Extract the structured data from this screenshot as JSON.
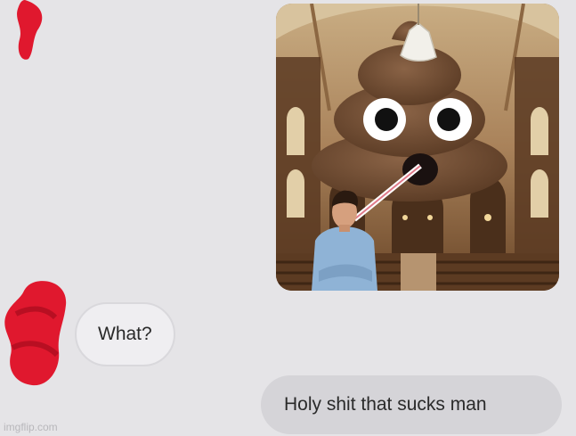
{
  "conversation": {
    "messages": [
      {
        "sender": "other",
        "kind": "image",
        "image_description": "poop emoji with a straw over a man inside a cathedral"
      },
      {
        "sender": "other",
        "kind": "text",
        "text": "What?"
      },
      {
        "sender": "me",
        "kind": "text",
        "text": "Holy shit that sucks man"
      }
    ]
  },
  "watermark": "imgflip.com",
  "colors": {
    "background": "#e5e4e7",
    "outgoing_bubble": "#d5d4d8",
    "incoming_bubble": "#efeef1",
    "redaction": "#e0182e"
  }
}
